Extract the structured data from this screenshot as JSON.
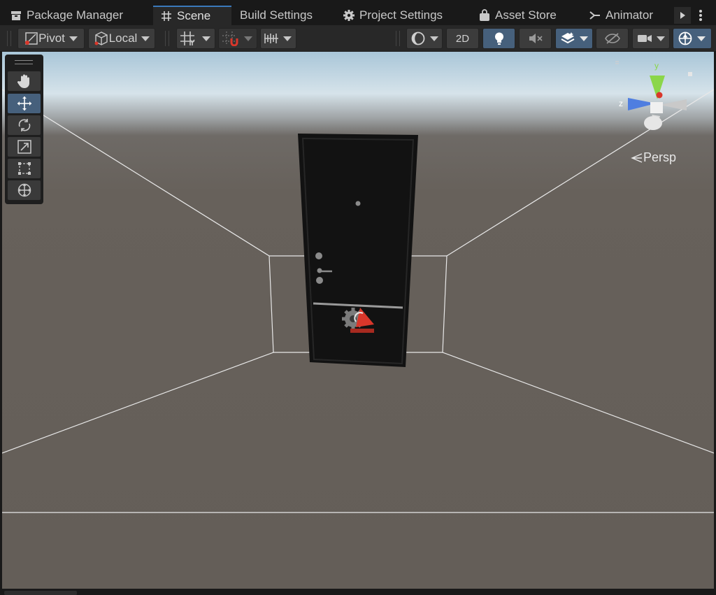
{
  "tabs": [
    {
      "label": "Package Manager",
      "icon": "package-icon",
      "active": false
    },
    {
      "label": "Scene",
      "icon": "grid-hash-icon",
      "active": true
    },
    {
      "label": "Build Settings",
      "icon": "",
      "active": false
    },
    {
      "label": "Project Settings",
      "icon": "gear-icon",
      "active": false
    },
    {
      "label": "Asset Store",
      "icon": "bag-icon",
      "active": false
    },
    {
      "label": "Animator",
      "icon": "animator-icon",
      "active": false
    }
  ],
  "toolbar": {
    "pivot_label": "Pivot",
    "local_label": "Local",
    "mode_2d_label": "2D"
  },
  "scene": {
    "projection_label": "Persp",
    "gizmo_axis_y": "y",
    "gizmo_axis_z": "z"
  },
  "colors": {
    "accent_active": "#46607c",
    "tab_highlight": "#3a79bb",
    "gizmo_y": "#8bd64a",
    "gizmo_z": "#4f7ee0",
    "gizmo_x": "#d9372b"
  }
}
